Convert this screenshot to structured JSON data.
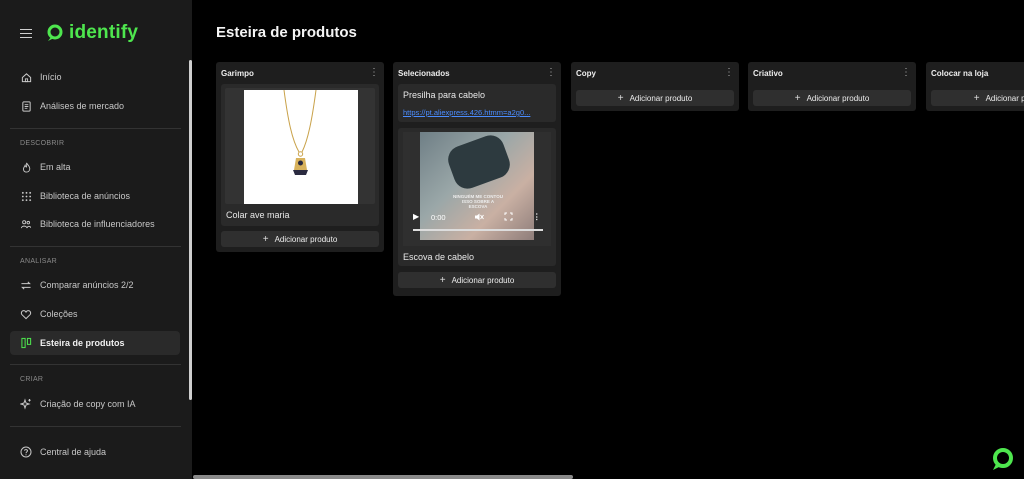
{
  "brand": {
    "name": "identify",
    "accent": "#4ee64e"
  },
  "sidebar": {
    "top_items": [
      {
        "label": "Início",
        "icon": "home-icon"
      },
      {
        "label": "Análises de mercado",
        "icon": "report-icon"
      }
    ],
    "sections": [
      {
        "label": "DESCOBRIR",
        "items": [
          {
            "label": "Em alta",
            "icon": "flame-icon"
          },
          {
            "label": "Biblioteca de anúncios",
            "icon": "grid-dots-icon"
          },
          {
            "label": "Biblioteca de influenciadores",
            "icon": "people-icon"
          }
        ]
      },
      {
        "label": "ANALISAR",
        "items": [
          {
            "label": "Comparar anúncios 2/2",
            "icon": "swap-icon"
          },
          {
            "label": "Coleções",
            "icon": "heart-icon"
          },
          {
            "label": "Esteira de produtos",
            "icon": "board-icon",
            "active": true
          }
        ]
      },
      {
        "label": "CRIAR",
        "items": [
          {
            "label": "Criação de copy com IA",
            "icon": "sparkle-icon"
          }
        ]
      }
    ],
    "bottom_item": {
      "label": "Central de ajuda",
      "icon": "help-icon"
    }
  },
  "page": {
    "title": "Esteira de produtos"
  },
  "board": {
    "add_label": "Adicionar produto",
    "columns": [
      {
        "title": "Garimpo",
        "cards": [
          {
            "type": "image",
            "label": "Colar ave maria"
          }
        ]
      },
      {
        "title": "Selecionados",
        "cards": [
          {
            "type": "link",
            "label": "Presilha para cabelo",
            "url_text": "https://pt.aliexpress.426.htmm=a2g0..."
          },
          {
            "type": "video",
            "label": "Escova de cabelo",
            "time": "0:00",
            "overlay_text": "NINGUÉM ME CONTOU ISSO SOBRE A ESCOVA"
          }
        ]
      },
      {
        "title": "Copy",
        "cards": []
      },
      {
        "title": "Criativo",
        "cards": []
      },
      {
        "title": "Colocar na loja",
        "cards": []
      }
    ]
  }
}
